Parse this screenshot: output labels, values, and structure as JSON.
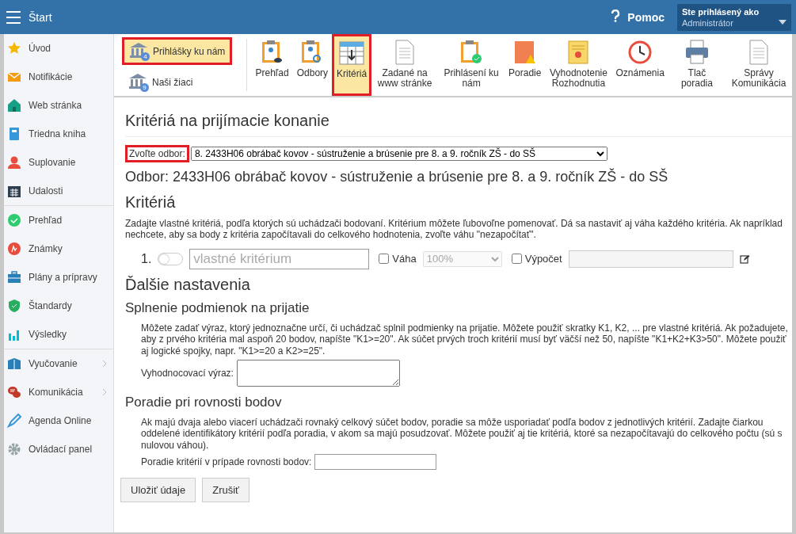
{
  "topbar": {
    "title": "Štart",
    "help": "Pomoc",
    "user_label": "Ste prihlásený ako",
    "user_name": "Administrátor"
  },
  "sidebar": {
    "groups": [
      [
        {
          "label": "Úvod",
          "has_submenu": false
        },
        {
          "label": "Notifikácie",
          "has_submenu": false
        },
        {
          "label": "Web stránka",
          "has_submenu": false
        },
        {
          "label": "Triedna kniha",
          "has_submenu": false
        },
        {
          "label": "Suplovanie",
          "has_submenu": false
        },
        {
          "label": "Udalosti",
          "has_submenu": false
        }
      ],
      [
        {
          "label": "Prehľad",
          "has_submenu": false
        },
        {
          "label": "Známky",
          "has_submenu": false
        },
        {
          "label": "Plány a prípravy",
          "has_submenu": false
        },
        {
          "label": "Štandardy",
          "has_submenu": false
        },
        {
          "label": "Výsledky",
          "has_submenu": false
        }
      ],
      [
        {
          "label": "Vyučovanie",
          "has_submenu": true
        },
        {
          "label": "Komunikácia",
          "has_submenu": true
        },
        {
          "label": "Agenda Online",
          "has_submenu": false
        },
        {
          "label": "Ovládací panel",
          "has_submenu": false
        }
      ]
    ]
  },
  "toolbar": {
    "side_buttons": [
      {
        "label": "Prihlášky ku nám",
        "badge": "4",
        "selected": true,
        "highlighted": true
      },
      {
        "label": "Naši žiaci",
        "badge": "9",
        "selected": false,
        "highlighted": false
      }
    ],
    "buttons": [
      {
        "label": "Prehľad",
        "selected": false,
        "highlighted": false
      },
      {
        "label": "Odbory",
        "selected": false,
        "highlighted": false
      },
      {
        "label": "Kritériá",
        "selected": true,
        "highlighted": true
      },
      {
        "label": "Zadané na www stránke",
        "selected": false,
        "highlighted": false
      },
      {
        "label": "Prihlásení ku nám",
        "selected": false,
        "highlighted": false
      },
      {
        "label": "Poradie",
        "selected": false,
        "highlighted": false
      },
      {
        "label": "Vyhodnotenie Rozhodnutia",
        "selected": false,
        "highlighted": false
      },
      {
        "label": "Oznámenia",
        "selected": false,
        "highlighted": false
      },
      {
        "label": "Tlač poradia",
        "selected": false,
        "highlighted": false
      },
      {
        "label": "Správy Komunikácia",
        "selected": false,
        "highlighted": false
      }
    ]
  },
  "page": {
    "title": "Kritériá na prijímacie konanie",
    "field_select": {
      "label": "Zvoľte odbor:",
      "label_highlighted": true,
      "value": "8. 2433H06 obrábač kovov - sústruženie a brúsenie pre 8. a 9. ročník ZŠ - do SŠ"
    },
    "field_heading": "Odbor: 2433H06 obrábač kovov - sústruženie a brúsenie pre 8. a 9. ročník ZŠ - do SŠ",
    "criteria_heading": "Kritériá",
    "criteria_help": "Zadajte vlastné kritériá, podľa ktorých sú uchádzači bodovaní. Kritérium môžete ľubovoľne pomenovať. Dá sa nastaviť aj váha každého kritéria. Ak napríklad nechcete, aby sa body z kritéria započítavali do celkového hodnotenia, zvoľte váhu \"nezapočítať\".",
    "criteria": [
      {
        "number": "1.",
        "on": false,
        "placeholder": "vlastné kritérium",
        "weight_label": "Váha",
        "weight_checked": false,
        "weight_value": "100%",
        "calc_label": "Výpočet",
        "calc_checked": false
      }
    ],
    "more_heading": "Ďalšie nastavenia",
    "sections": [
      {
        "heading": "Splnenie podmienok na prijatie",
        "text": "Môžete zadať výraz, ktorý jednoznačne určí, či uchádzač splnil podmienky na prijatie. Môžete použiť skratky K1, K2, ... pre vlastné kritériá. Ak požadujete, aby z prvého kritéria mal aspoň 20 bodov, napíšte \"K1>=20\". Ak súčet prvých troch kritérií musí byť väčší než 50, napíšte \"K1+K2+K3>50\". Môžete použiť aj logické spojky, napr. \"K1>=20 a K2>=25\".",
        "field_label": "Vyhodnocovací výraz:",
        "kind": "textarea"
      },
      {
        "heading": "Poradie pri rovnosti bodov",
        "text": "Ak majú dvaja alebo viacerí uchádzači rovnaký celkový súčet bodov, poradie sa môže usporiadať podľa bodov z jednotlivých kritérií. Zadajte čiarkou oddelené identifikátory kritérií podľa poradia, v akom sa majú posudzovať. Môžete použiť aj tie kritériá, ktoré sa nezapočítavajú do celkového počtu (sú s nulovou váhou).",
        "field_label": "Poradie kritérií v prípade rovnosti bodov:",
        "kind": "input"
      }
    ],
    "buttons": [
      "Uložiť údaje",
      "Zrušiť"
    ]
  }
}
